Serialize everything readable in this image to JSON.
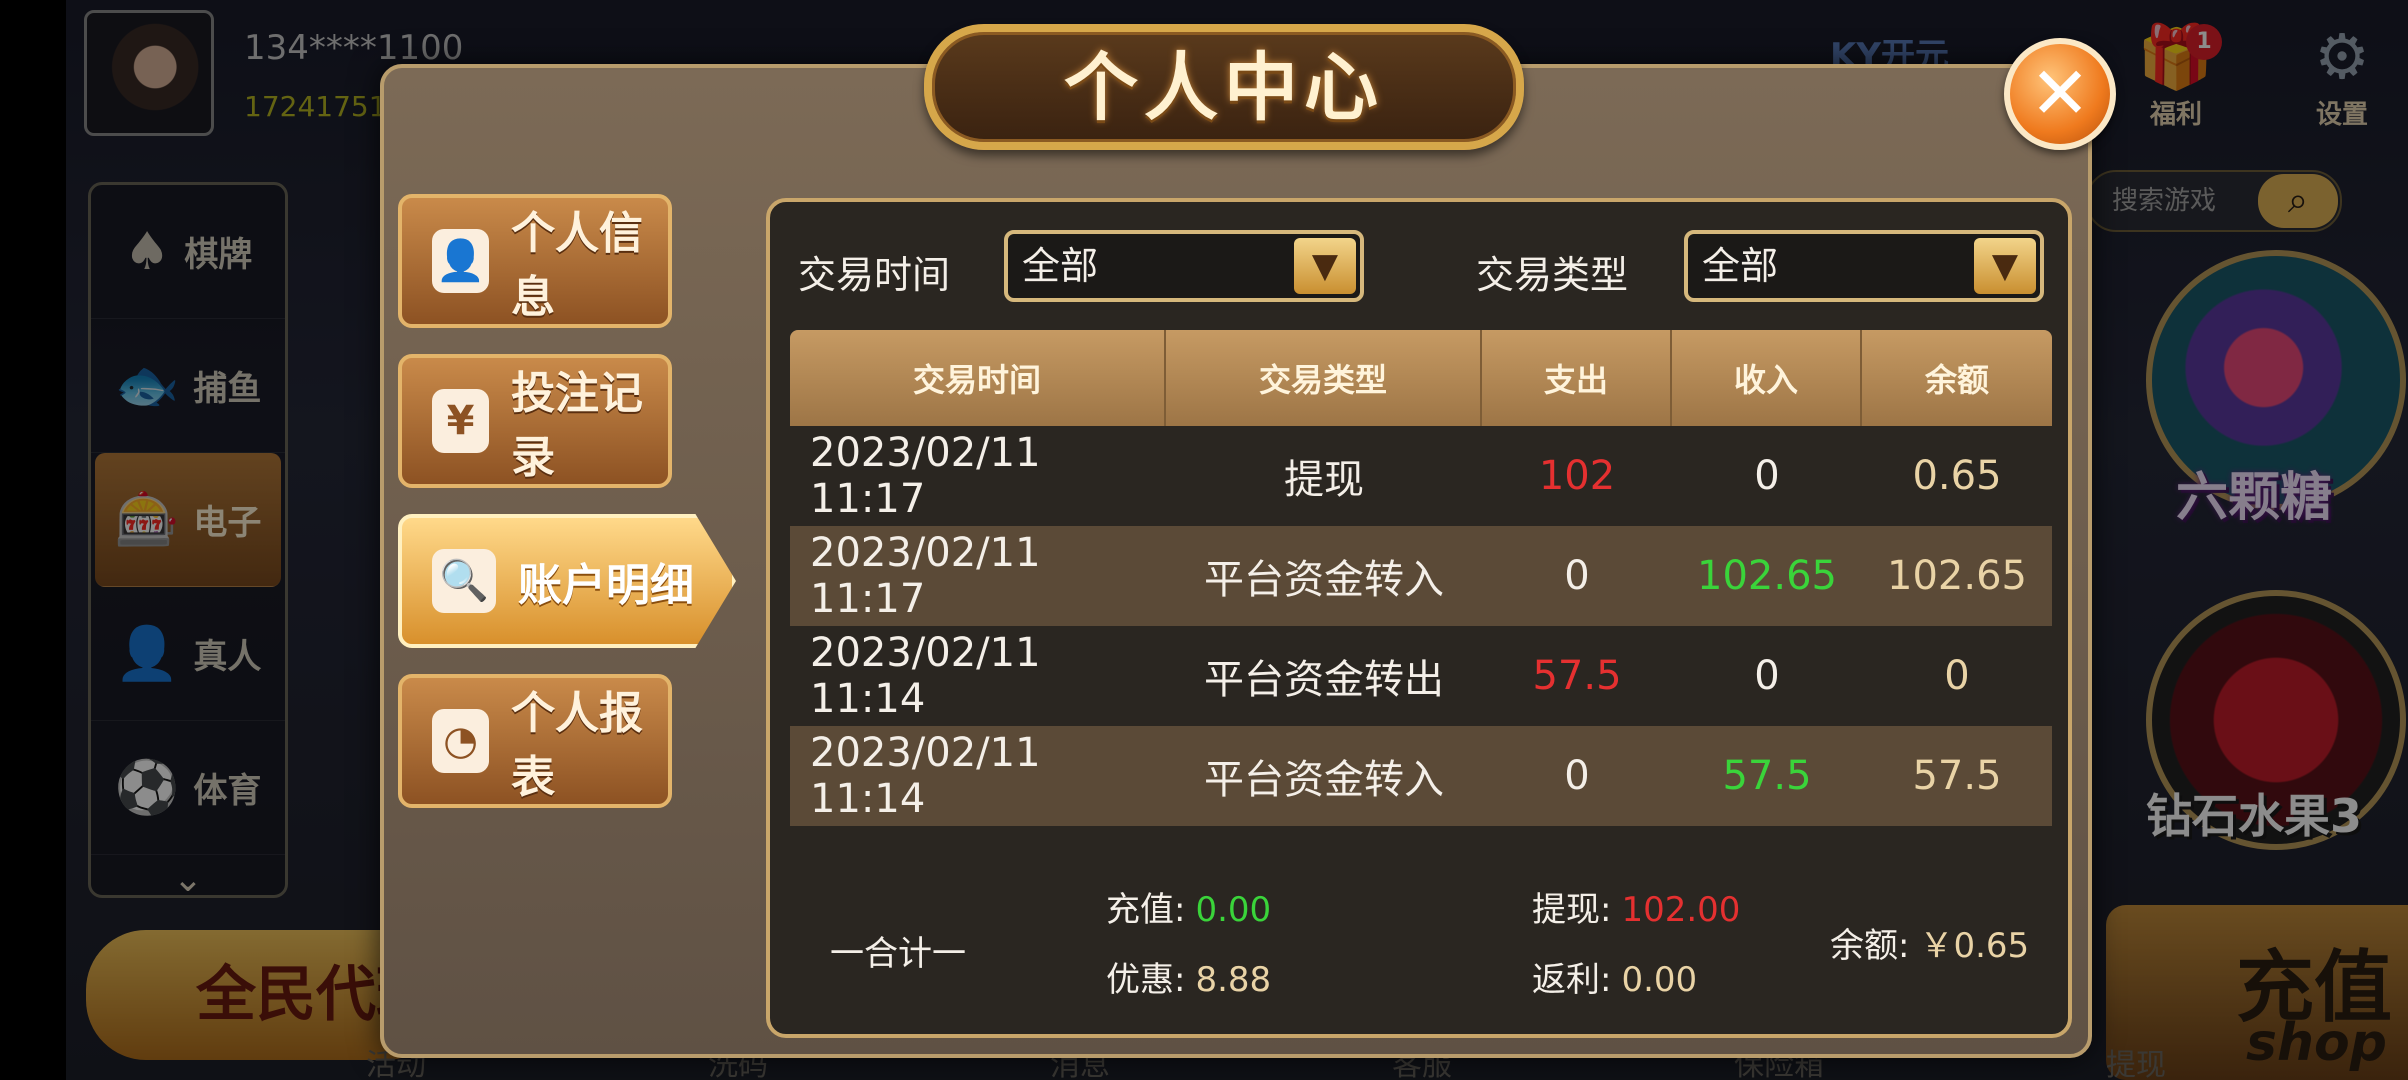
{
  "lobby": {
    "user_phone": "134****1100",
    "user_id": "17241751",
    "brand": "KY开元",
    "gift_label": "福利",
    "gift_badge": "1",
    "settings_label": "设置",
    "search_placeholder": "搜索游戏",
    "nav": [
      {
        "label": "棋牌",
        "icon": "cards-icon"
      },
      {
        "label": "捕鱼",
        "icon": "fish-icon"
      },
      {
        "label": "电子",
        "icon": "slot-machine-icon"
      },
      {
        "label": "真人",
        "icon": "dealer-icon"
      },
      {
        "label": "体育",
        "icon": "soccer-ball-icon"
      }
    ],
    "agent_label": "全民代理",
    "games": [
      {
        "label": "六颗糖"
      },
      {
        "label": "钻石水果3"
      }
    ],
    "charge_label": "充值",
    "charge_sub": "shop",
    "bottom_nav": [
      "活动",
      "洗码",
      "消息",
      "客服",
      "保险箱",
      "提现"
    ]
  },
  "modal": {
    "title": "个人中心",
    "close_symbol": "✕",
    "menu": [
      {
        "label": "个人信息",
        "icon": "user-icon",
        "active": false
      },
      {
        "label": "投注记录",
        "icon": "money-icon",
        "active": false
      },
      {
        "label": "账户明细",
        "icon": "document-search-icon",
        "active": true
      },
      {
        "label": "个人报表",
        "icon": "pie-chart-icon",
        "active": false
      }
    ],
    "filters": {
      "time_label": "交易时间",
      "time_value": "全部",
      "type_label": "交易类型",
      "type_value": "全部"
    },
    "table": {
      "headers": [
        "交易时间",
        "交易类型",
        "支出",
        "收入",
        "余额"
      ],
      "rows": [
        {
          "time": "2023/02/11  11:17",
          "type": "提现",
          "out": "102",
          "in": "0",
          "balance": "0.65"
        },
        {
          "time": "2023/02/11  11:17",
          "type": "平台资金转入",
          "out": "0",
          "in": "102.65",
          "balance": "102.65"
        },
        {
          "time": "2023/02/11  11:14",
          "type": "平台资金转出",
          "out": "57.5",
          "in": "0",
          "balance": "0"
        },
        {
          "time": "2023/02/11  11:14",
          "type": "平台资金转入",
          "out": "0",
          "in": "57.5",
          "balance": "57.5"
        }
      ]
    },
    "summary": {
      "title": "一合计一",
      "recharge_label": "充值:",
      "recharge_value": "0.00",
      "bonus_label": "优惠:",
      "bonus_value": "8.88",
      "withdraw_label": "提现:",
      "withdraw_value": "102.00",
      "rebate_label": "返利:",
      "rebate_value": "0.00",
      "balance_label": "余额:",
      "balance_value": "￥0.65"
    }
  },
  "colors": {
    "expense_red": "#e53030",
    "income_green": "#3ad43a",
    "gold": "#d6b87c"
  }
}
